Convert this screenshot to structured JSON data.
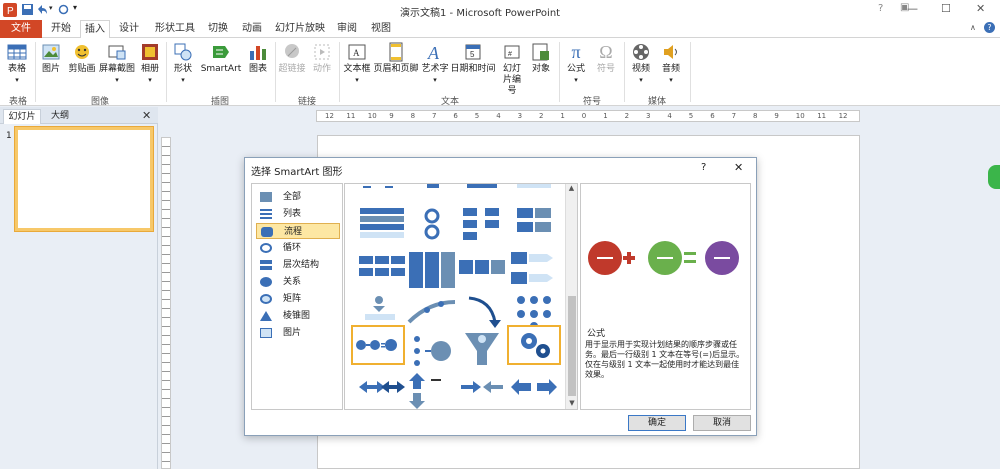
{
  "titlebar": {
    "title": "演示文稿1 - Microsoft PowerPoint"
  },
  "tabs": [
    "文件",
    "开始",
    "插入",
    "设计",
    "形状工具",
    "切换",
    "动画",
    "幻灯片放映",
    "审阅",
    "视图"
  ],
  "ribbon": {
    "buttons": [
      "表格",
      "图片",
      "剪贴画",
      "屏幕截图",
      "相册",
      "形状",
      "SmartArt",
      "图表",
      "超链接",
      "动作",
      "文本框",
      "页眉和页脚",
      "艺术字",
      "日期和时间",
      "幻灯片编号",
      "对象",
      "公式",
      "符号",
      "视频",
      "音频"
    ],
    "groups": [
      "表格",
      "图像",
      "插图",
      "链接",
      "文本",
      "符号",
      "媒体"
    ]
  },
  "left_panel": {
    "tabs": [
      "幻灯片",
      "大纲"
    ],
    "slide_number": "1"
  },
  "ruler": {
    "h_labels": [
      "12",
      "11",
      "10",
      "9",
      "8",
      "7",
      "6",
      "5",
      "4",
      "3",
      "2",
      "1",
      "0",
      "1",
      "2",
      "3",
      "4",
      "5",
      "6",
      "7",
      "8",
      "9",
      "10",
      "11",
      "12"
    ]
  },
  "dialog": {
    "title": "选择 SmartArt 图形",
    "help": "?",
    "close": "✕",
    "categories": [
      "全部",
      "列表",
      "流程",
      "循环",
      "层次结构",
      "关系",
      "矩阵",
      "棱锥图",
      "图片"
    ],
    "selected_category": "流程",
    "preview_name": "公式",
    "preview_desc": "用于显示用于实现计划结果的顺序步骤或任务。最后一行级别 1 文本在等号(=)后显示。仅在与级别 1 文本一起使用时才能达到最佳效果。",
    "ok": "确定",
    "cancel": "取消"
  },
  "colors": {
    "accent_file": "#d24726",
    "selection": "#fde7a3",
    "dialog_border": "#8aa0b8"
  }
}
